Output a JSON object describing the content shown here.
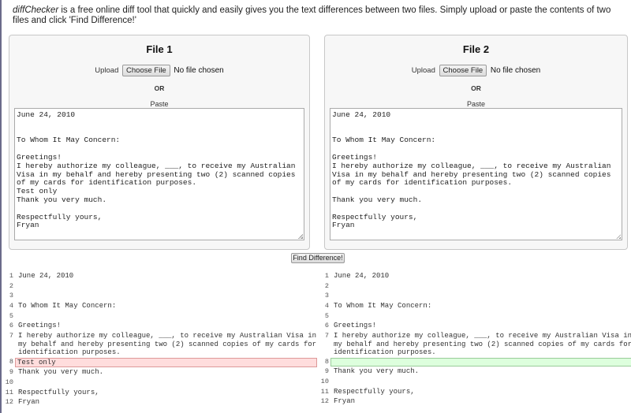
{
  "intro": {
    "brand": "diffChecker",
    "text": " is a free online diff tool that quickly and easily gives you the text differences between two files. Simply upload or paste the contents of two files and click 'Find Difference!'"
  },
  "files": [
    {
      "title": "File 1",
      "upload_label": "Upload",
      "choose_label": "Choose File",
      "no_file": "No file chosen",
      "or": "OR",
      "paste_label": "Paste",
      "content": "June 24, 2010\n\n\nTo Whom It May Concern:\n\nGreetings!\nI hereby authorize my colleague, ___, to receive my Australian Visa in my behalf and hereby presenting two (2) scanned copies of my cards for identification purposes.\nTest only\nThank you very much.\n\nRespectfully yours,\nFryan"
    },
    {
      "title": "File 2",
      "upload_label": "Upload",
      "choose_label": "Choose File",
      "no_file": "No file chosen",
      "or": "OR",
      "paste_label": "Paste",
      "content": "June 24, 2010\n\n\nTo Whom It May Concern:\n\nGreetings!\nI hereby authorize my colleague, ___, to receive my Australian Visa in my behalf and hereby presenting two (2) scanned copies of my cards for identification purposes.\n\nThank you very much.\n\nRespectfully yours,\nFryan"
    }
  ],
  "find_button": "Find Difference!",
  "diff": {
    "left": [
      {
        "n": "1",
        "t": "June 24, 2010"
      },
      {
        "n": "2",
        "t": ""
      },
      {
        "n": "3",
        "t": ""
      },
      {
        "n": "4",
        "t": "To Whom It May Concern:"
      },
      {
        "n": "5",
        "t": ""
      },
      {
        "n": "6",
        "t": "Greetings!"
      },
      {
        "n": "7",
        "t": "I hereby authorize my colleague, ___, to receive my Australian Visa in my behalf and hereby presenting two (2) scanned copies of my cards for identification purposes."
      },
      {
        "n": "8",
        "t": "Test only",
        "type": "del"
      },
      {
        "n": "9",
        "t": "Thank you very much."
      },
      {
        "n": "10",
        "t": ""
      },
      {
        "n": "11",
        "t": "Respectfully yours,"
      },
      {
        "n": "12",
        "t": "Fryan"
      }
    ],
    "right": [
      {
        "n": "1",
        "t": "June 24, 2010"
      },
      {
        "n": "2",
        "t": ""
      },
      {
        "n": "3",
        "t": ""
      },
      {
        "n": "4",
        "t": "To Whom It May Concern:"
      },
      {
        "n": "5",
        "t": ""
      },
      {
        "n": "6",
        "t": "Greetings!"
      },
      {
        "n": "7",
        "t": "I hereby authorize my colleague, ___, to receive my Australian Visa in my behalf and hereby presenting two (2) scanned copies of my cards for identification purposes."
      },
      {
        "n": "8",
        "t": "",
        "type": "ins"
      },
      {
        "n": "9",
        "t": "Thank you very much."
      },
      {
        "n": "10",
        "t": ""
      },
      {
        "n": "11",
        "t": "Respectfully yours,"
      },
      {
        "n": "12",
        "t": "Fryan"
      }
    ]
  },
  "colors": {
    "deleted": "#ffdddd",
    "inserted": "#ddffdd"
  }
}
